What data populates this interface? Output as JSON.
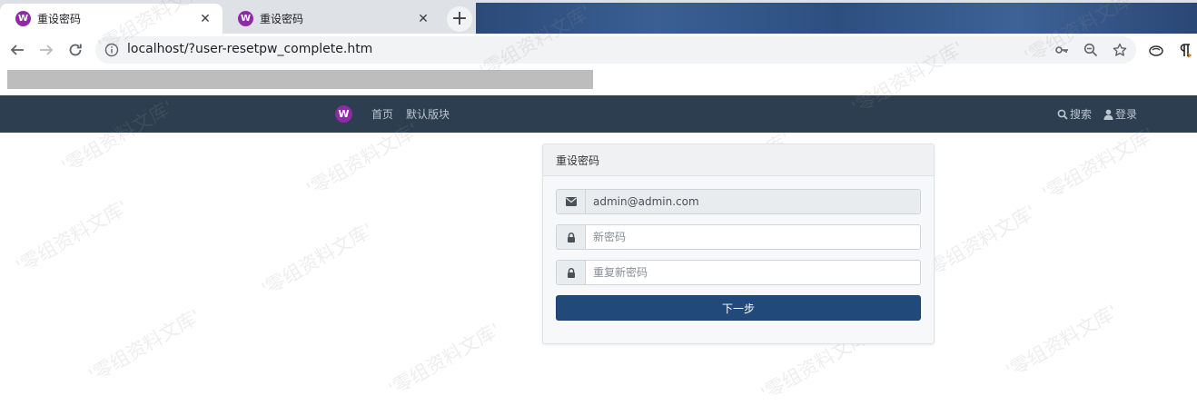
{
  "browser": {
    "tabs": [
      {
        "title": "重设密码",
        "favicon": "W",
        "active": true
      },
      {
        "title": "重设密码",
        "favicon": "W",
        "active": false
      }
    ],
    "close_glyph": "✕",
    "new_tab_glyph": "+",
    "url": "localhost/?user-resetpw_complete.htm"
  },
  "site": {
    "logo_letter": "W",
    "nav": [
      {
        "label": "首页"
      },
      {
        "label": "默认版块"
      }
    ],
    "search_label": "搜索",
    "login_label": "登录"
  },
  "form": {
    "title": "重设密码",
    "email_value": "admin@admin.com",
    "new_password_placeholder": "新密码",
    "repeat_password_placeholder": "重复新密码",
    "submit_label": "下一步"
  },
  "watermark": {
    "text": "'零组资料文库'"
  },
  "colors": {
    "navbar_bg": "#2c3e50",
    "brand_purple": "#8e2aa6",
    "button_bg": "#214a7a"
  }
}
